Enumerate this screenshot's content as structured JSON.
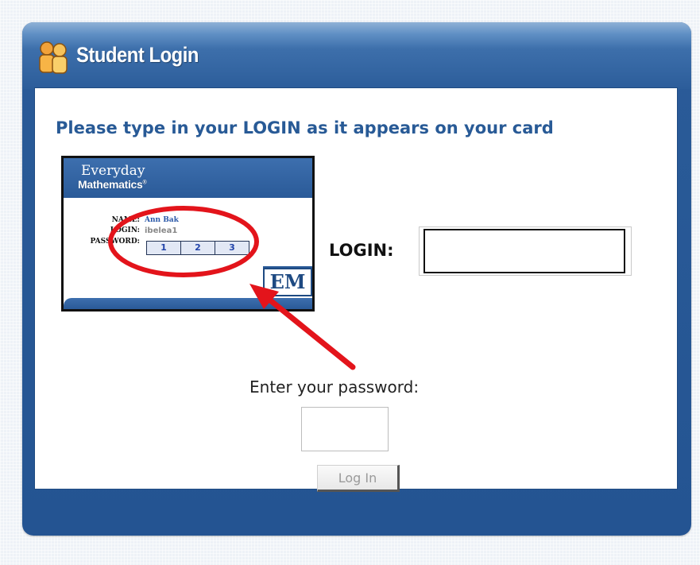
{
  "header": {
    "title": "Student Login",
    "icon": "students-icon"
  },
  "instruction": "Please type in your LOGIN as it appears on your card",
  "card": {
    "brand_line1": "Everyday",
    "brand_line2": "Mathematics",
    "brand_mark": "®",
    "name_label": "NAME:",
    "name_value": "Ann Bak",
    "login_label": "LOGIN:",
    "login_value": "ibelea1",
    "password_label": "PASSWORD:",
    "password_boxes": [
      "1",
      "2",
      "3"
    ],
    "logo": "EM"
  },
  "login": {
    "label": "LOGIN:",
    "value": "",
    "placeholder": ""
  },
  "password": {
    "label": "Enter your password:",
    "value": ""
  },
  "button": {
    "label": "Log In"
  },
  "colors": {
    "panel_blue": "#2a5b98",
    "instruction_blue": "#285a96",
    "annotation_red": "#e3141b"
  }
}
